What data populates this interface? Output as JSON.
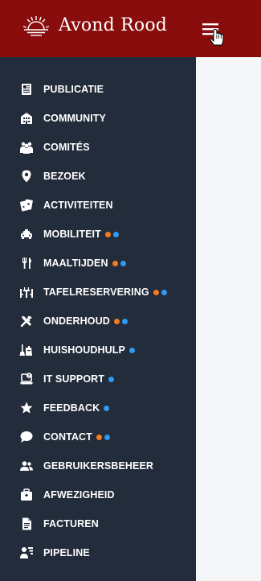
{
  "header": {
    "brand": "Avond Rood",
    "logo_icon": "sun-logo-icon",
    "menu_icon": "hamburger-menu-icon",
    "color": "#8a0d0d"
  },
  "colors": {
    "sidebar": "#232c3b",
    "dot_orange": "#f47b20",
    "dot_blue": "#2f9bf0"
  },
  "sidebar": {
    "items": [
      {
        "label": "PUBLICATIE",
        "icon": "newspaper-icon",
        "dots": []
      },
      {
        "label": "COMMUNITY",
        "icon": "buildings-icon",
        "dots": []
      },
      {
        "label": "COMITÉS",
        "icon": "group-icon",
        "dots": []
      },
      {
        "label": "BEZOEK",
        "icon": "location-pin-icon",
        "dots": []
      },
      {
        "label": "ACTIVITEITEN",
        "icon": "cards-icon",
        "dots": []
      },
      {
        "label": "MOBILITEIT",
        "icon": "taxi-icon",
        "dots": [
          "orange",
          "blue"
        ]
      },
      {
        "label": "MAALTIJDEN",
        "icon": "cutlery-icon",
        "dots": [
          "orange",
          "blue"
        ]
      },
      {
        "label": "TAFELRESERVERING",
        "icon": "table-icon",
        "dots": [
          "orange",
          "blue"
        ]
      },
      {
        "label": "ONDERHOUD",
        "icon": "tools-icon",
        "dots": [
          "orange",
          "blue"
        ]
      },
      {
        "label": "HUISHOUDHULP",
        "icon": "cleaning-icon",
        "dots": [
          "blue"
        ]
      },
      {
        "label": "IT SUPPORT",
        "icon": "laptop-support-icon",
        "dots": [
          "blue"
        ]
      },
      {
        "label": "FEEDBACK",
        "icon": "star-icon",
        "dots": [
          "blue"
        ]
      },
      {
        "label": "CONTACT",
        "icon": "chat-bubble-icon",
        "dots": [
          "orange",
          "blue"
        ]
      },
      {
        "label": "GEBRUIKERSBEHEER",
        "icon": "users-icon",
        "dots": []
      },
      {
        "label": "AFWEZIGHEID",
        "icon": "suitcase-icon",
        "dots": []
      },
      {
        "label": "FACTUREN",
        "icon": "document-icon",
        "dots": []
      },
      {
        "label": "PIPELINE",
        "icon": "user-pipeline-icon",
        "dots": []
      }
    ]
  }
}
